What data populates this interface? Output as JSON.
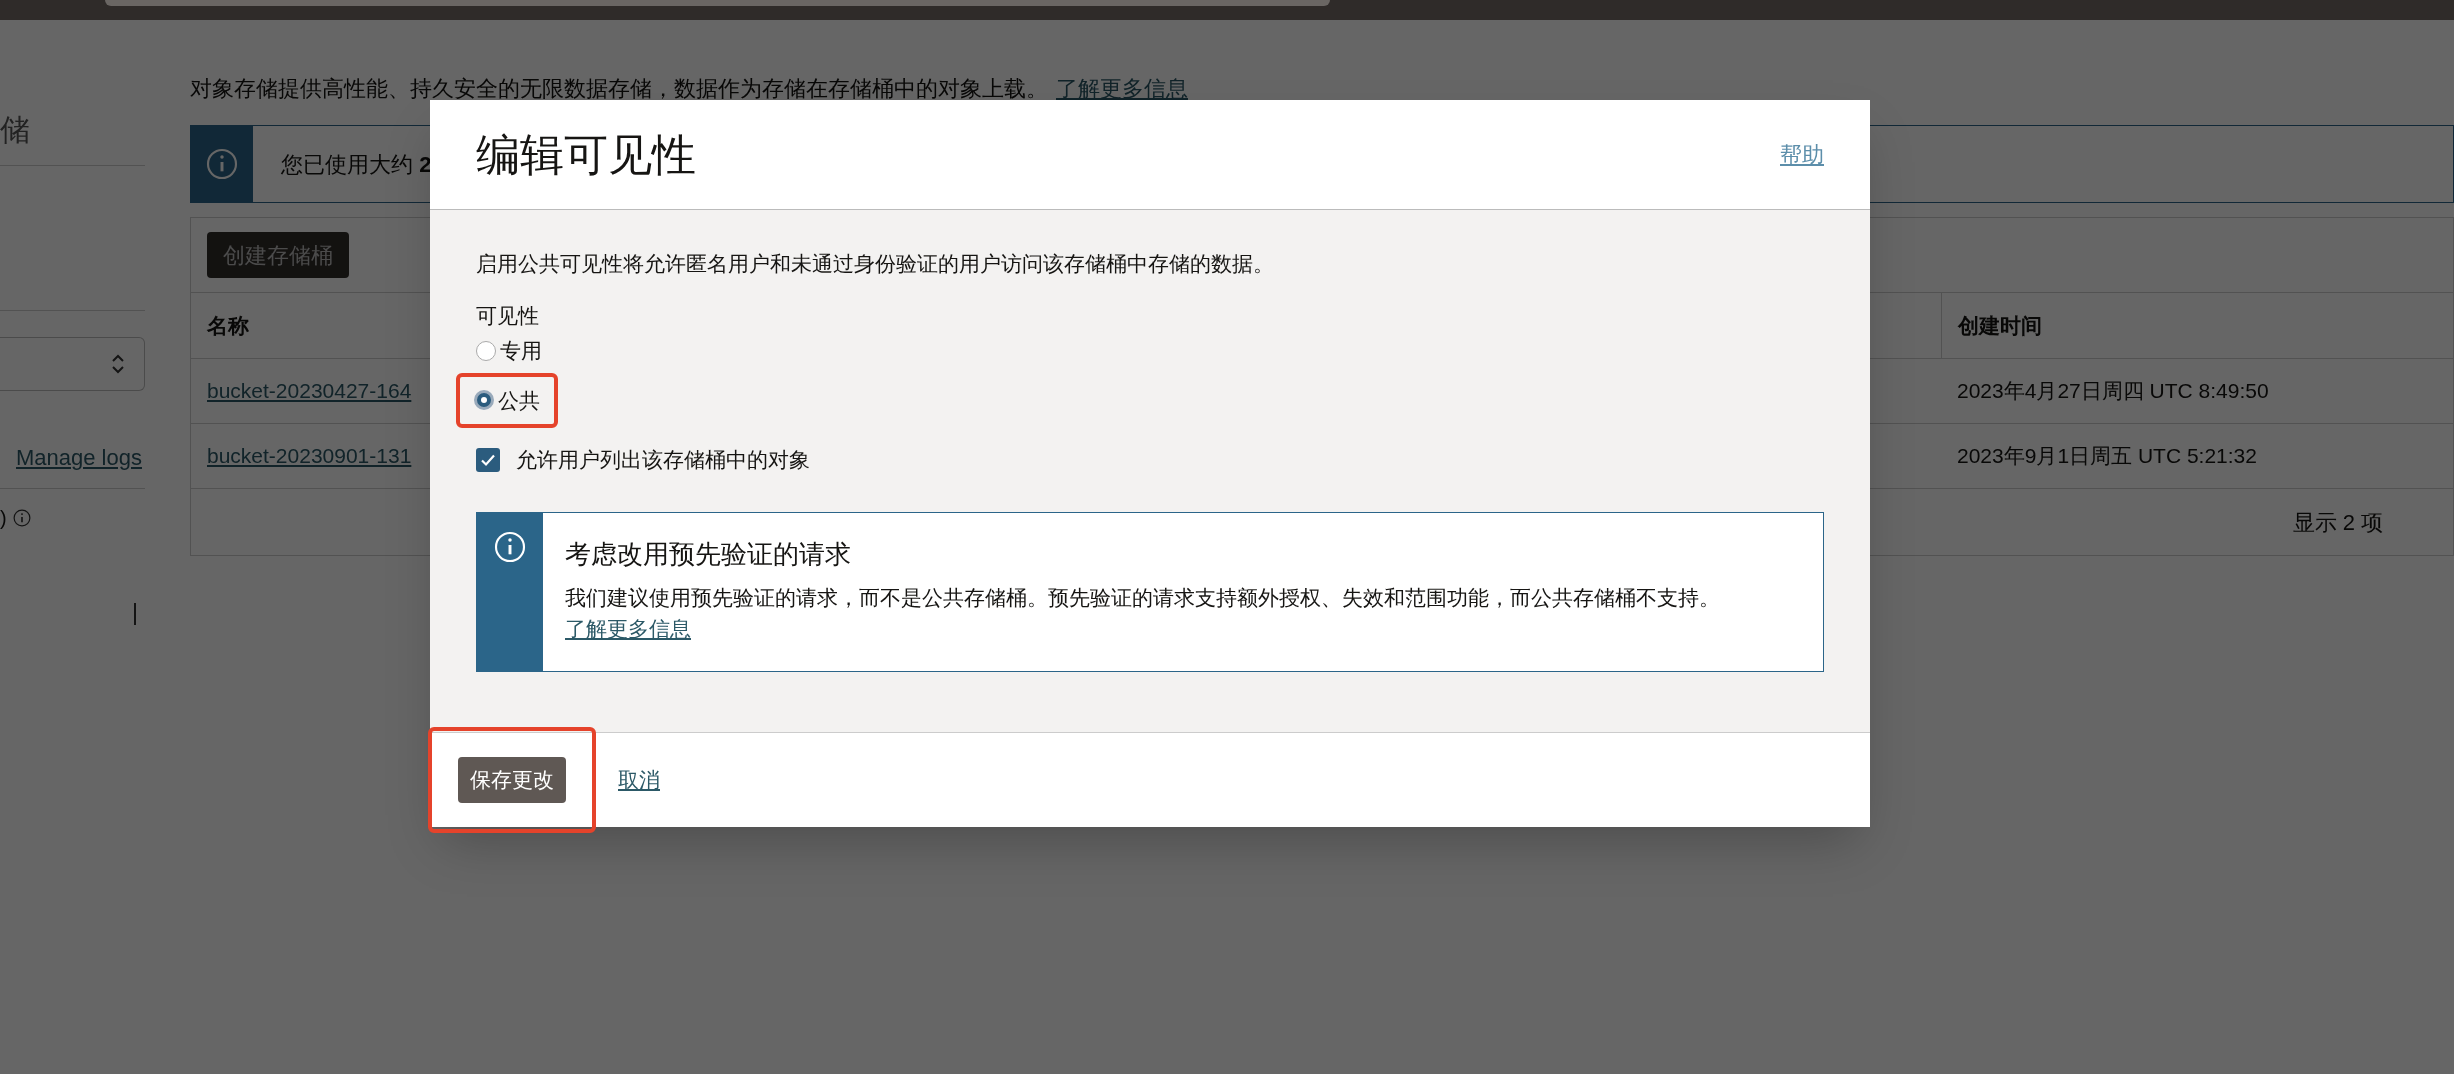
{
  "sidebar": {
    "title": "储",
    "link": "Manage logs",
    "note": ")"
  },
  "page": {
    "description": "对象存储提供高性能、持久安全的无限数据存储，数据作为存储在存储桶中的对象上载。",
    "learn_more": "了解更多信息",
    "usage_banner": "您已使用大约 **2**",
    "create_button": "创建存储桶",
    "table": {
      "columns": [
        "名称",
        "创建时间"
      ],
      "rows": [
        {
          "name": "bucket-20230427-164",
          "created": "2023年4月27日周四 UTC 8:49:50"
        },
        {
          "name": "bucket-20230901-131",
          "created": "2023年9月1日周五 UTC 5:21:32"
        }
      ],
      "footer": "显示 2 项"
    }
  },
  "dialog": {
    "title": "编辑可见性",
    "help": "帮助",
    "description": "启用公共可见性将允许匿名用户和未通过身份验证的用户访问该存储桶中存储的数据。",
    "visibility_label": "可见性",
    "options": [
      {
        "label": "专用",
        "selected": false,
        "highlighted": false
      },
      {
        "label": "公共",
        "selected": true,
        "highlighted": true
      }
    ],
    "allow_listing": {
      "label": "允许用户列出该存储桶中的对象",
      "checked": true
    },
    "notice": {
      "title": "考虑改用预先验证的请求",
      "text": "我们建议使用预先验证的请求，而不是公共存储桶。预先验证的请求支持额外授权、失效和范围功能，而公共存储桶不支持。",
      "link": "了解更多信息"
    },
    "save_button": {
      "label": "保存更改",
      "highlighted": true
    },
    "cancel": "取消"
  }
}
